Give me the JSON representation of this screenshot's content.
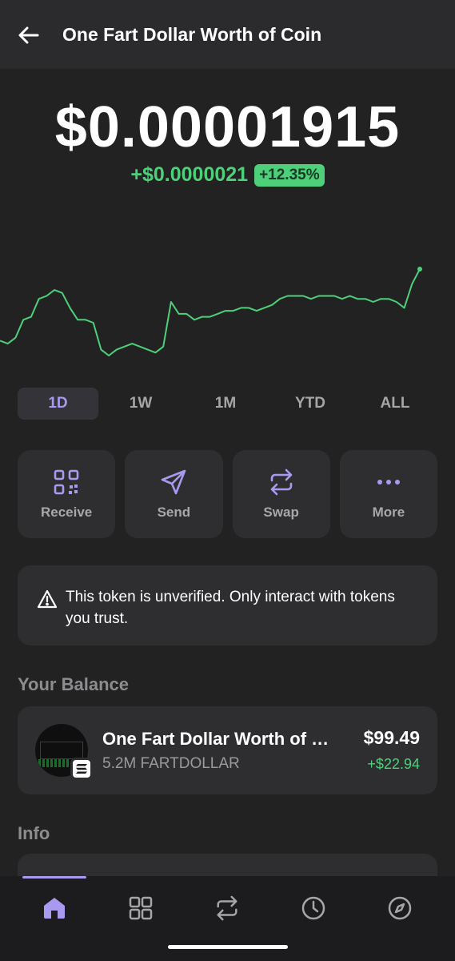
{
  "header": {
    "title": "One Fart Dollar Worth of Coin",
    "back_icon": "arrow-left-icon"
  },
  "price": {
    "value": "$0.00001915",
    "change": "+$0.0000021",
    "change_pct": "+12.35%"
  },
  "chart_data": {
    "type": "line",
    "color": "#4ed07a",
    "values": [
      11,
      10,
      12,
      18,
      19,
      25,
      26,
      28,
      27,
      22,
      18,
      18,
      17,
      8,
      6,
      8,
      9,
      10,
      9,
      8,
      7,
      9,
      24,
      20,
      20,
      18,
      19,
      19,
      20,
      21,
      21,
      22,
      22,
      21,
      22,
      23,
      25,
      26,
      26,
      26,
      25,
      26,
      26,
      26,
      25,
      26,
      25,
      25,
      24,
      25,
      25,
      24,
      22,
      30,
      35
    ]
  },
  "ranges": [
    "1D",
    "1W",
    "1M",
    "YTD",
    "ALL"
  ],
  "active_range": "1D",
  "actions": [
    {
      "label": "Receive",
      "icon": "qr-code-icon"
    },
    {
      "label": "Send",
      "icon": "send-icon"
    },
    {
      "label": "Swap",
      "icon": "swap-icon"
    },
    {
      "label": "More",
      "icon": "more-dots-icon"
    }
  ],
  "warning": {
    "text": "This token is unverified. Only interact with tokens you trust.",
    "icon": "warning-icon"
  },
  "balance": {
    "section_title": "Your Balance",
    "token_name": "One Fart Dollar Worth of Coin",
    "amount": "5.2M FARTDOLLAR",
    "usd_value": "$99.49",
    "usd_change": "+$22.94"
  },
  "info": {
    "section_title": "Info"
  },
  "tabbar": [
    "home-icon",
    "grid-icon",
    "swap-icon",
    "clock-icon",
    "compass-icon"
  ],
  "colors": {
    "accent": "#a99af0",
    "positive": "#4ed07a",
    "background": "#222222",
    "card": "#2e2e31"
  }
}
